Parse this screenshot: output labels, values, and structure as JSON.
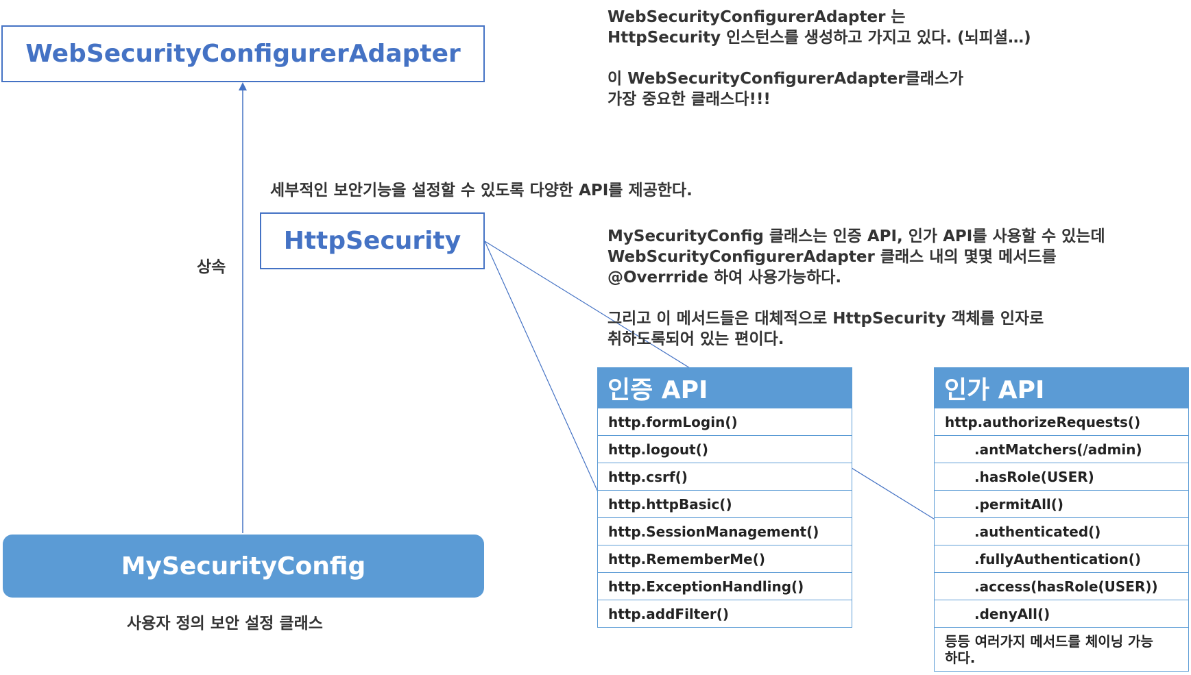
{
  "diagram": {
    "top_class": "WebSecurityConfigurerAdapter",
    "http_security": "HttpSecurity",
    "custom_class": "MySecurityConfig",
    "inherit_label": "상속",
    "custom_class_caption": "사용자 정의 보안 설정 클래스",
    "http_security_desc": "세부적인 보안기능을 설정할 수 있도록 다양한 API를 제공한다.",
    "note_top": "WebSecurityConfigurerAdapter 는\nHttpSecurity 인스턴스를 생성하고 가지고 있다. (뇌피셜…)\n\n이 WebSecurityConfigurerAdapter클래스가\n가장 중요한 클래스다!!!",
    "note_middle": "MySecurityConfig 클래스는 인증 API, 인가 API를 사용할 수 있는데\nWebScurityConfigurerAdapter 클래스 내의 몇몇 메서드를\n@Overrride 하여 사용가능하다.\n\n그리고 이 메서드들은 대체적으로 HttpSecurity 객체를 인자로\n취하도록되어 있는 편이다."
  },
  "auth_panel": {
    "title": "인증 API",
    "items": [
      "http.formLogin()",
      "http.logout()",
      "http.csrf()",
      "http.httpBasic()",
      "http.SessionManagement()",
      "http.RememberMe()",
      "http.ExceptionHandling()",
      "http.addFilter()"
    ]
  },
  "authz_panel": {
    "title": "인가 API",
    "items": [
      "http.authorizeRequests()",
      ".antMatchers(/admin)",
      ".hasRole(USER)",
      ".permitAll()",
      ".authenticated()",
      ".fullyAuthentication()",
      ".access(hasRole(USER))",
      ".denyAll()"
    ],
    "note": "등등 여러가지 메서드를 체이닝 가능\n하다."
  },
  "colors": {
    "accent": "#4472c4",
    "panel": "#5b9bd5"
  }
}
